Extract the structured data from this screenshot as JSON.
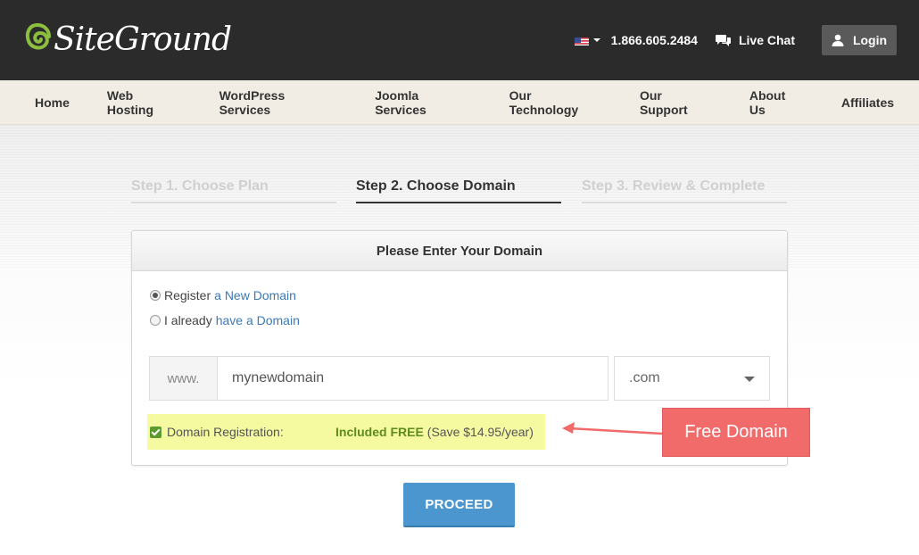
{
  "header": {
    "logo_text": "SiteGround",
    "phone": "1.866.605.2484",
    "live_chat_label": "Live Chat",
    "login_label": "Login",
    "icons": [
      "siteground-logo-icon",
      "us-flag-icon",
      "chat-icon",
      "user-icon"
    ]
  },
  "nav": {
    "items": [
      "Home",
      "Web Hosting",
      "WordPress Services",
      "Joomla Services",
      "Our Technology",
      "Our Support",
      "About Us",
      "Affiliates"
    ]
  },
  "steps": [
    {
      "label": "Step 1. Choose Plan",
      "state": "inactive"
    },
    {
      "label": "Step 2. Choose Domain",
      "state": "active"
    },
    {
      "label": "Step 3. Review & Complete",
      "state": "inactive"
    }
  ],
  "panel": {
    "title": "Please Enter Your Domain",
    "options": [
      {
        "prefix": "Register",
        "link": "a New Domain",
        "checked": true
      },
      {
        "prefix": "I already",
        "link": "have a Domain",
        "checked": false
      }
    ],
    "www_prefix": "www.",
    "domain_value": "mynewdomain",
    "tld_selected": ".com",
    "registration_label": "Domain Registration:",
    "included_text": "Included FREE",
    "save_text": "(Save $14.95/year)"
  },
  "annotation": {
    "label": "Free Domain",
    "color": "#f26b6b"
  },
  "proceed_label": "PROCEED",
  "colors": {
    "header_bg": "#2b2b2b",
    "nav_bg": "#f2ede4",
    "accent_blue": "#4b96cf",
    "link_blue": "#3a7ab8",
    "free_green": "#5f8c1f",
    "highlight_yellow": "#f5f9a0"
  }
}
